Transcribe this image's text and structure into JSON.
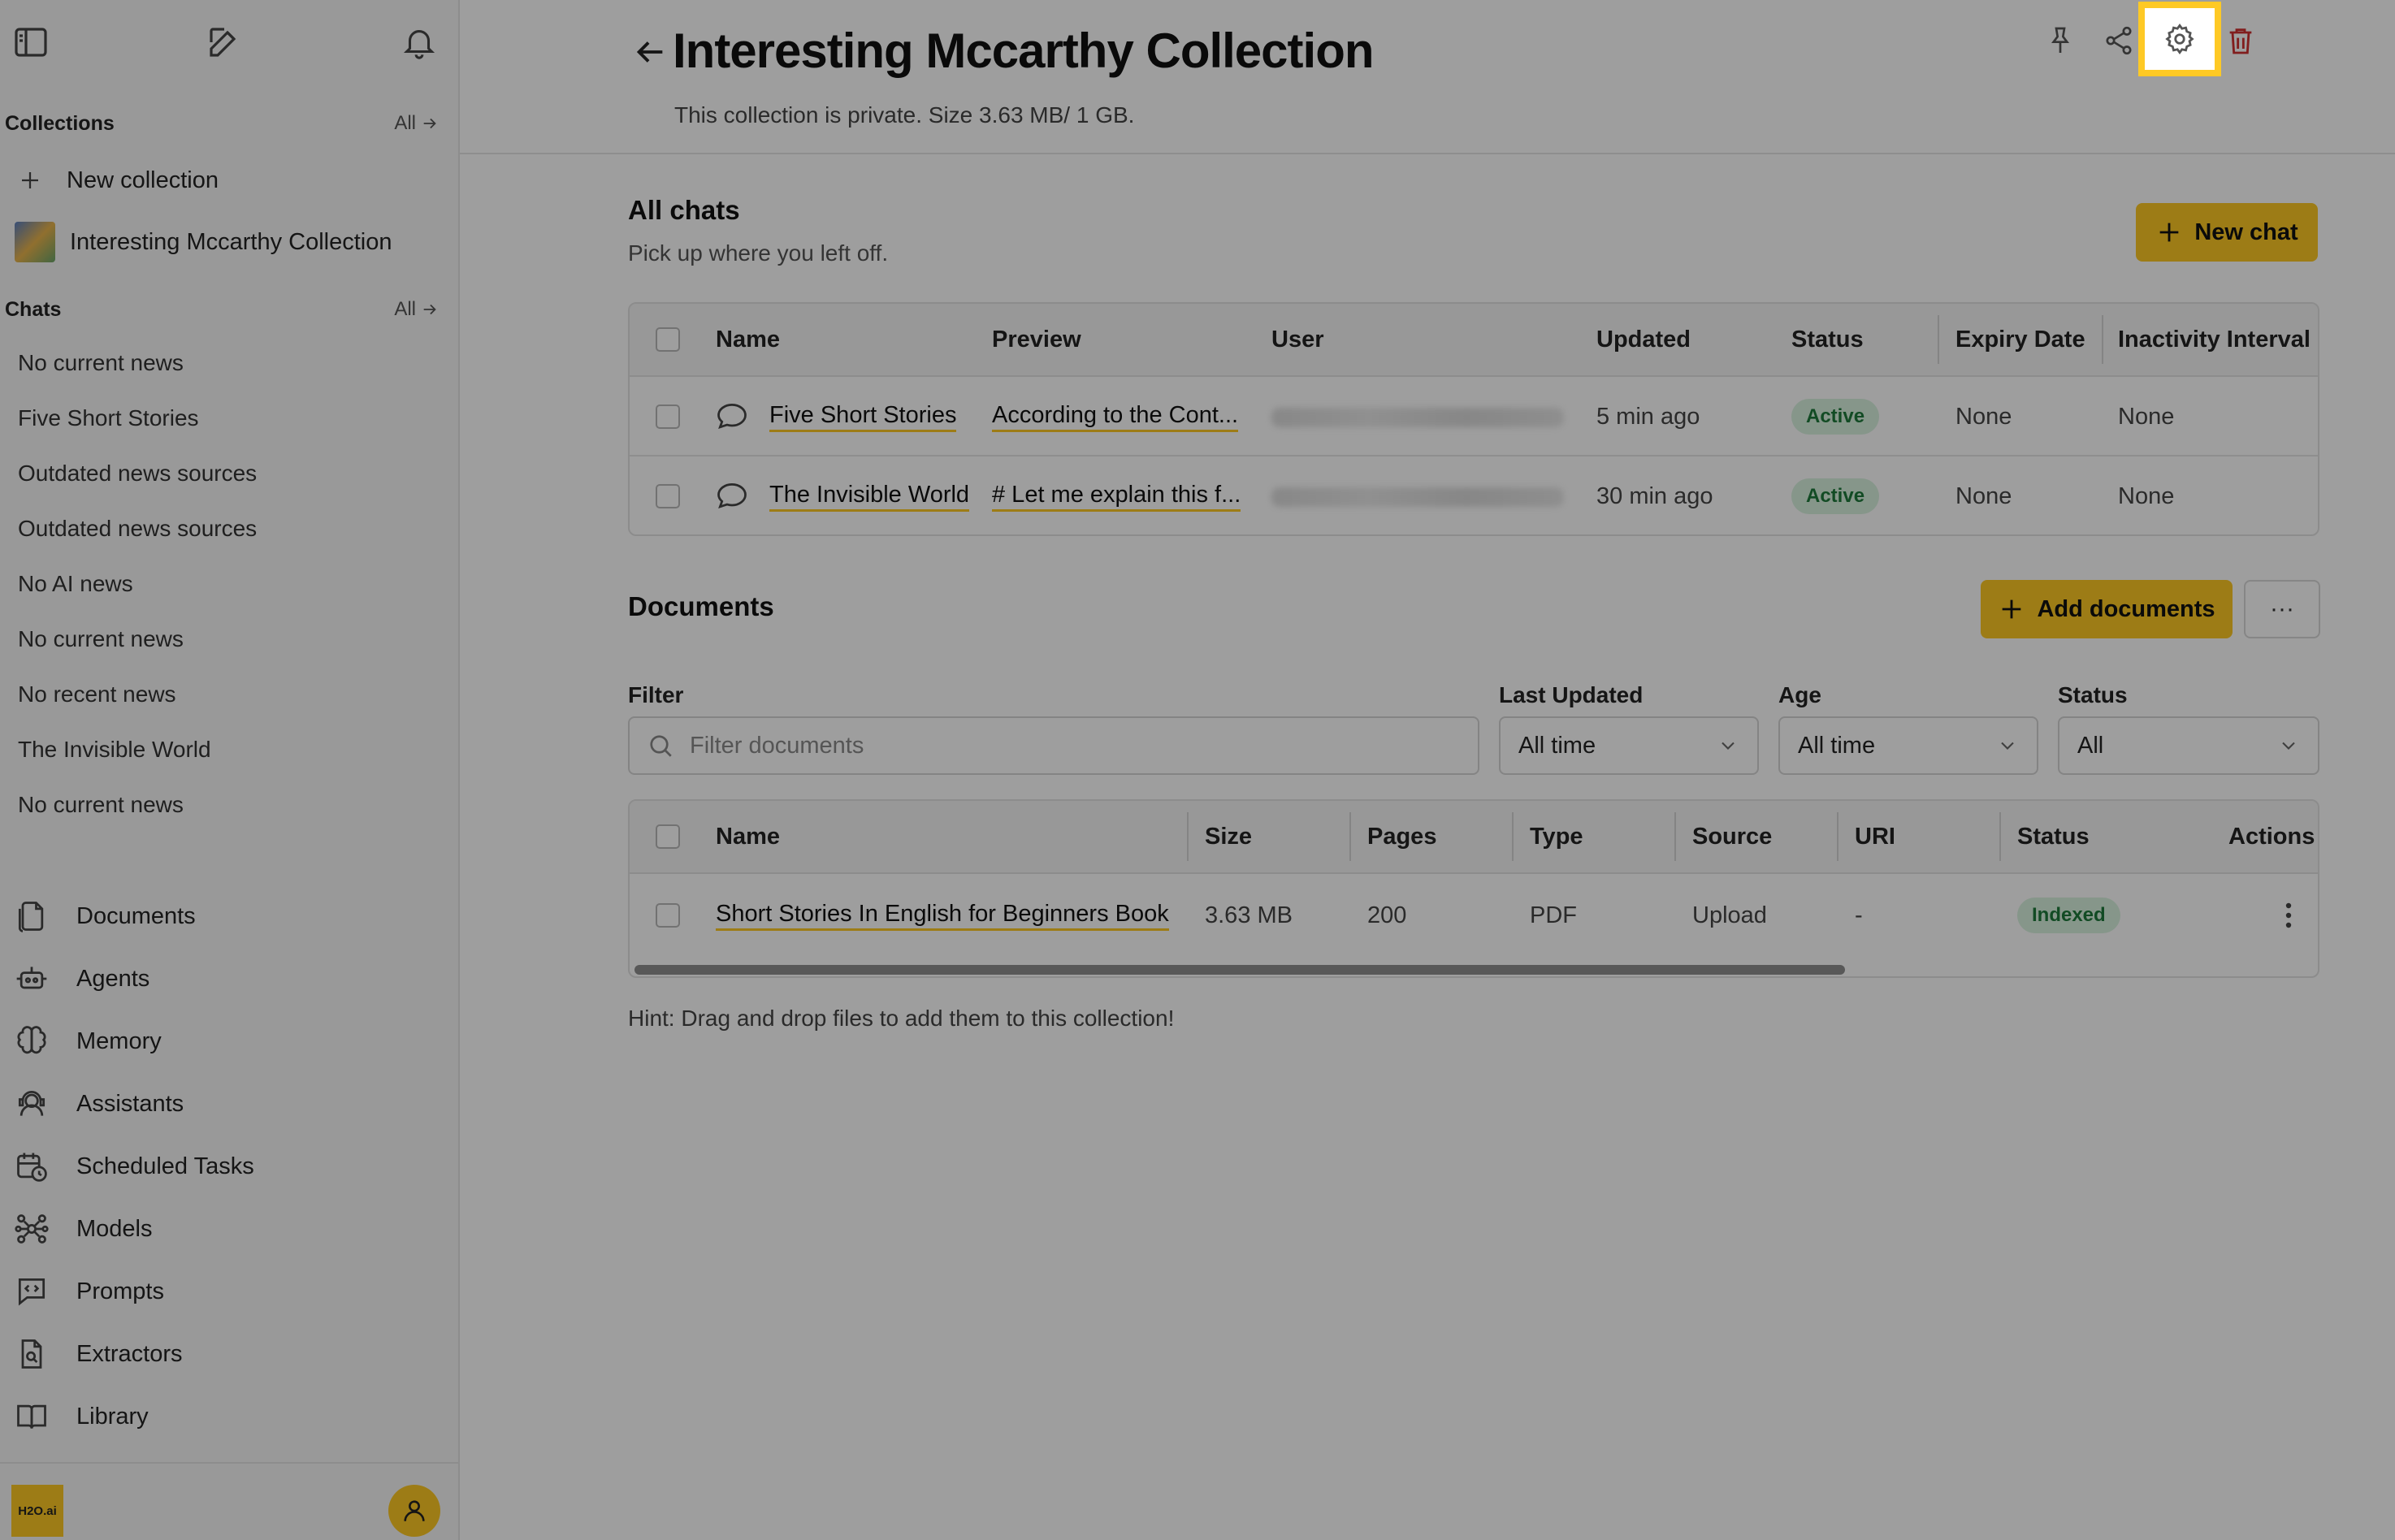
{
  "sidebar": {
    "collections_heading": "Collections",
    "collections_all": "All",
    "new_collection": "New collection",
    "collection_item": "Interesting Mccarthy Collection",
    "chats_heading": "Chats",
    "chats_all": "All",
    "chats": [
      "No current news",
      "Five Short Stories",
      "Outdated news sources",
      "Outdated news sources",
      "No AI news",
      "No current news",
      "No recent news",
      "The Invisible World",
      "No current news"
    ],
    "nav": [
      {
        "label": "Documents",
        "icon": "documents-icon"
      },
      {
        "label": "Agents",
        "icon": "robot-icon"
      },
      {
        "label": "Memory",
        "icon": "brain-icon"
      },
      {
        "label": "Assistants",
        "icon": "assistant-icon"
      },
      {
        "label": "Scheduled Tasks",
        "icon": "calendar-clock-icon"
      },
      {
        "label": "Models",
        "icon": "network-icon"
      },
      {
        "label": "Prompts",
        "icon": "code-chat-icon"
      },
      {
        "label": "Extractors",
        "icon": "file-search-icon"
      },
      {
        "label": "Library",
        "icon": "book-icon"
      }
    ],
    "logo_text": "H2O.ai"
  },
  "header": {
    "title": "Interesting Mccarthy Collection",
    "subtitle": "This collection is private. Size 3.63 MB/ 1 GB."
  },
  "chats_section": {
    "title": "All chats",
    "subtitle": "Pick up where you left off.",
    "new_chat": "New chat",
    "columns": [
      "Name",
      "Preview",
      "User",
      "Updated",
      "Status",
      "Expiry Date",
      "Inactivity Interval"
    ],
    "rows": [
      {
        "name": "Five Short Stories",
        "preview": "According to the Cont...",
        "updated": "5 min ago",
        "status": "Active",
        "expiry": "None",
        "inactivity": "None"
      },
      {
        "name": "The Invisible World",
        "preview": "# Let me explain this f...",
        "updated": "30 min ago",
        "status": "Active",
        "expiry": "None",
        "inactivity": "None"
      }
    ]
  },
  "documents_section": {
    "title": "Documents",
    "add_documents": "Add documents",
    "more": "···",
    "filter_label": "Filter",
    "filter_placeholder": "Filter documents",
    "last_updated_label": "Last Updated",
    "last_updated_value": "All time",
    "age_label": "Age",
    "age_value": "All time",
    "status_label": "Status",
    "status_value": "All",
    "columns": [
      "Name",
      "Size",
      "Pages",
      "Type",
      "Source",
      "URI",
      "Status",
      "Actions"
    ],
    "rows": [
      {
        "name": "Short Stories In English for Beginners Book",
        "size": "3.63 MB",
        "pages": "200",
        "type": "PDF",
        "source": "Upload",
        "uri": "-",
        "status": "Indexed"
      }
    ],
    "hint": "Hint: Drag and drop files to add them to this collection!"
  },
  "colors": {
    "accent": "#fec925",
    "status_green_bg": "#d8f2df",
    "status_green_text": "#1e7a3a",
    "danger": "#d03030"
  }
}
